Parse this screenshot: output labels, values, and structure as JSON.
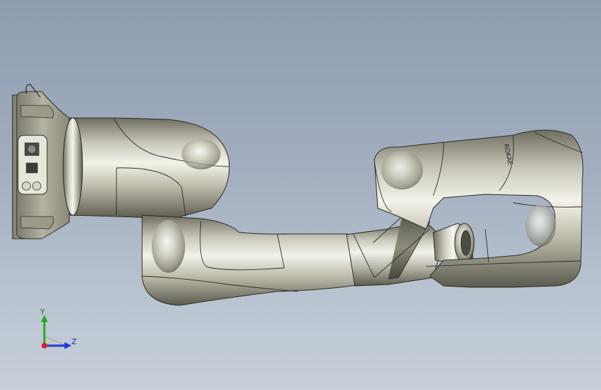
{
  "viewport": {
    "background_top": "#8f9cb0",
    "background_bottom": "#c7cfd9"
  },
  "model": {
    "name": "robot-arm-assembly",
    "body_color": "#bdbcae",
    "edge_color": "#2a2a24",
    "label_on_forearm": "ROKAE"
  },
  "triad": {
    "y_label": "Y",
    "z_label": "Z",
    "y_color": "#22aa22",
    "z_color": "#1f3fd6",
    "x_color": "#d42020"
  }
}
